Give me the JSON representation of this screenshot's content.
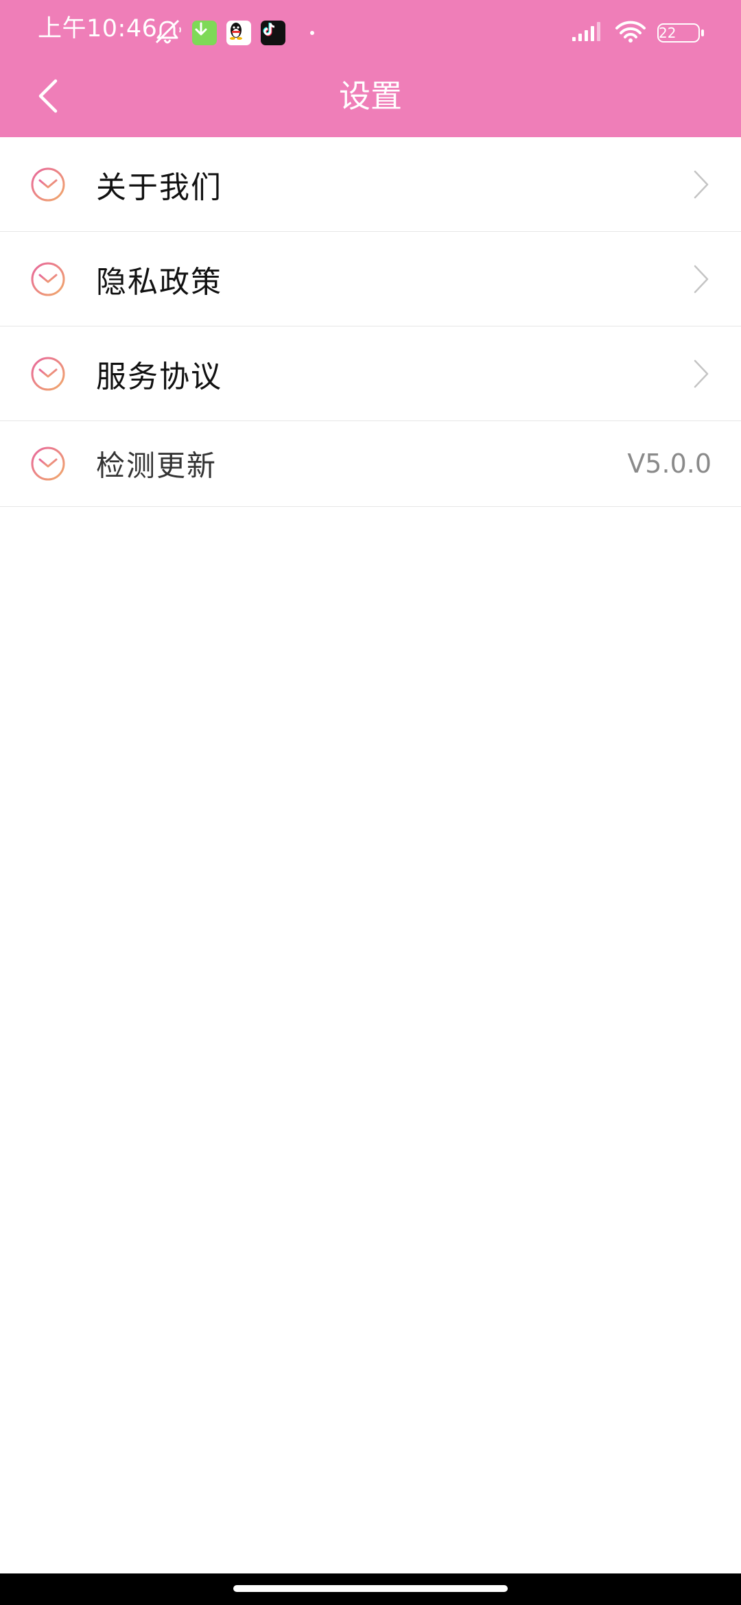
{
  "status_bar": {
    "time": "上午10:46",
    "battery": "22",
    "icons_left": [
      "bell-off-icon",
      "download-app-icon",
      "qq-app-icon",
      "tiktok-app-icon",
      "dot-icon"
    ],
    "icons_right": [
      "signal-icon",
      "wifi-icon",
      "battery-icon"
    ]
  },
  "header": {
    "title": "设置",
    "back_icon": "chevron-left-icon",
    "background": "#ef7eb8"
  },
  "settings": {
    "items": [
      {
        "label": "关于我们",
        "icon": "smile-badge-icon",
        "trailing": "chevron-right-icon"
      },
      {
        "label": "隐私政策",
        "icon": "smile-badge-icon",
        "trailing": "chevron-right-icon"
      },
      {
        "label": "服务协议",
        "icon": "smile-badge-icon",
        "trailing": "chevron-right-icon"
      },
      {
        "label": "检测更新",
        "icon": "smile-badge-icon",
        "value": "V5.0.0"
      }
    ]
  },
  "colors": {
    "accent": "#ef7eb8",
    "icon_gradient_start": "#e7669b",
    "icon_gradient_end": "#f0a96a",
    "divider": "#e6e6e6",
    "value_text": "#8a8a8a"
  }
}
